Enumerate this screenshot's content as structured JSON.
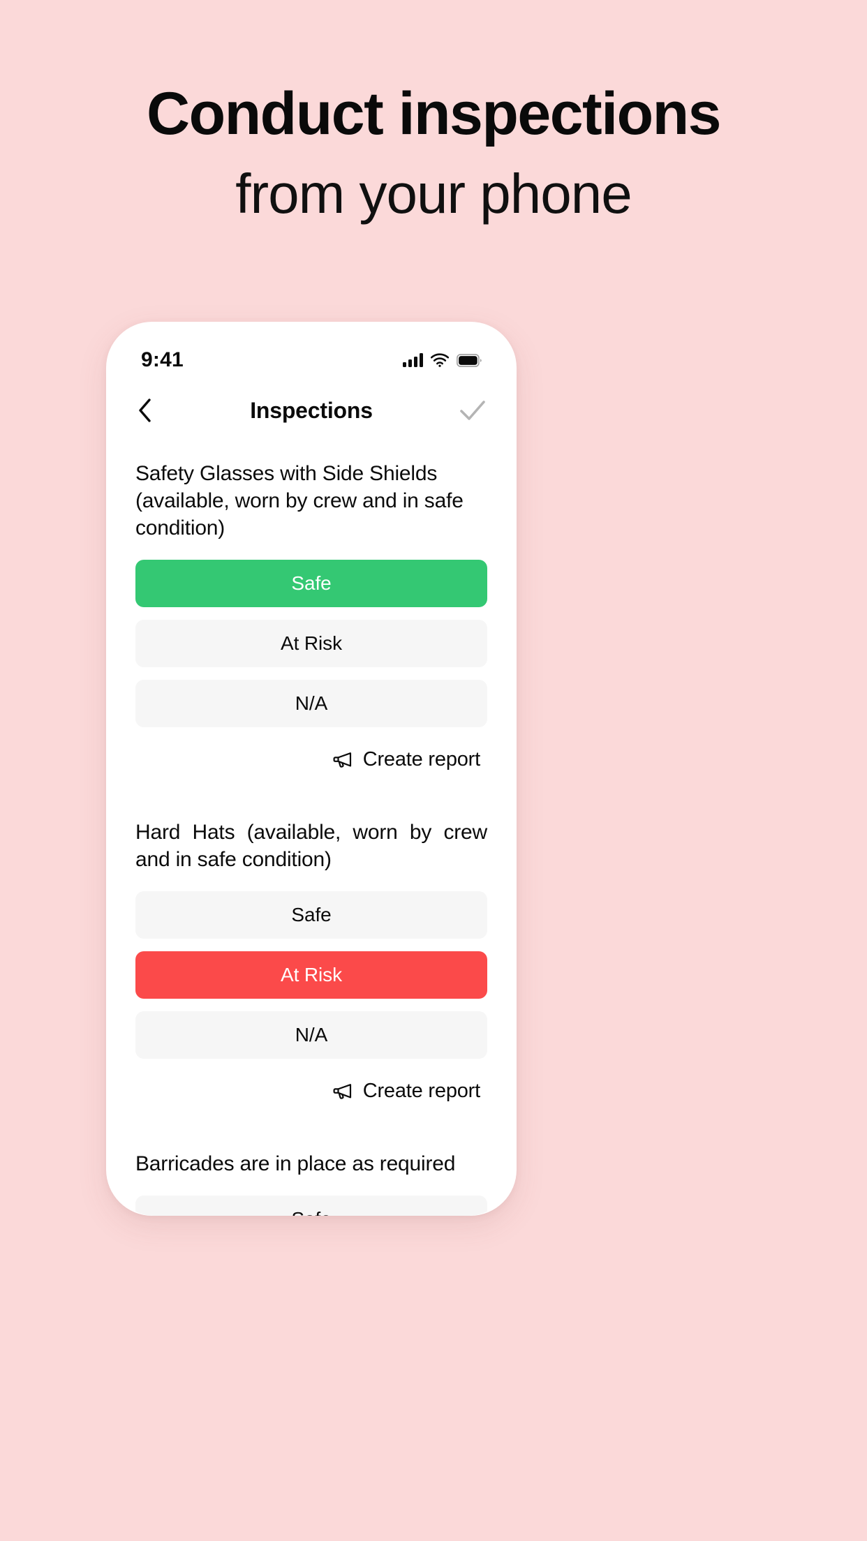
{
  "hero": {
    "title": "Conduct inspections",
    "subtitle": "from your phone",
    "background_color": "#FBD9D9"
  },
  "phone": {
    "status_bar": {
      "time": "9:41",
      "signal_icon": "cellular-signal-icon",
      "wifi_icon": "wifi-icon",
      "battery_icon": "battery-full-icon"
    },
    "nav_bar": {
      "back_icon": "chevron-left-icon",
      "title": "Inspections",
      "confirm_icon": "check-icon",
      "confirm_color": "#B4B4B4"
    },
    "colors": {
      "safe": "#34C873",
      "at_risk": "#FB4A4A",
      "inactive": "#F6F6F6"
    },
    "create_report_label": "Create report",
    "create_report_icon": "megaphone-icon",
    "items": [
      {
        "question": "Safety Glasses with Side Shields (available, worn by crew and in safe condition)",
        "options": [
          {
            "label": "Safe",
            "state": "selected-safe"
          },
          {
            "label": "At Risk",
            "state": "inactive"
          },
          {
            "label": "N/A",
            "state": "inactive"
          }
        ]
      },
      {
        "question": "Hard Hats (available, worn by crew and in safe condition)",
        "options": [
          {
            "label": "Safe",
            "state": "inactive"
          },
          {
            "label": "At Risk",
            "state": "selected-risk"
          },
          {
            "label": "N/A",
            "state": "inactive"
          }
        ]
      },
      {
        "question": "Barricades are in place as required",
        "options": [
          {
            "label": "Safe",
            "state": "inactive"
          }
        ]
      }
    ]
  }
}
